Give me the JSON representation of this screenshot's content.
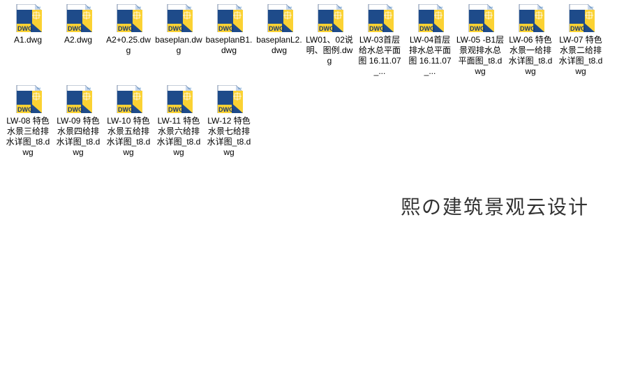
{
  "files": [
    {
      "name": "A1.dwg"
    },
    {
      "name": "A2.dwg"
    },
    {
      "name": "A2+0.25.dwg"
    },
    {
      "name": "baseplan.dwg"
    },
    {
      "name": "baseplanB1.dwg"
    },
    {
      "name": "baseplanL2.dwg"
    },
    {
      "name": "LW01、02说明、图例.dwg"
    },
    {
      "name": "LW-03首层给水总平面图 16.11.07_..."
    },
    {
      "name": "LW-04首层排水总平面图 16.11.07_..."
    },
    {
      "name": "LW-05 -B1层景观排水总平面图_t8.dwg"
    },
    {
      "name": "LW-06 特色水景一给排水详图_t8.dwg"
    },
    {
      "name": "LW-07 特色水景二给排水详图_t8.dwg"
    },
    {
      "name": "LW-08 特色水景三给排水详图_t8.dwg"
    },
    {
      "name": "LW-09 特色水景四给排水详图_t8.dwg"
    },
    {
      "name": "LW-10 特色水景五给排水详图_t8.dwg"
    },
    {
      "name": "LW-11 特色水景六给排水详图_t8.dwg"
    },
    {
      "name": "LW-12 特色水景七给排水详图_t8.dwg"
    }
  ],
  "watermark": "熙の建筑景观云设计",
  "icon": {
    "dwg_label": "DWG",
    "tm": "TM"
  }
}
